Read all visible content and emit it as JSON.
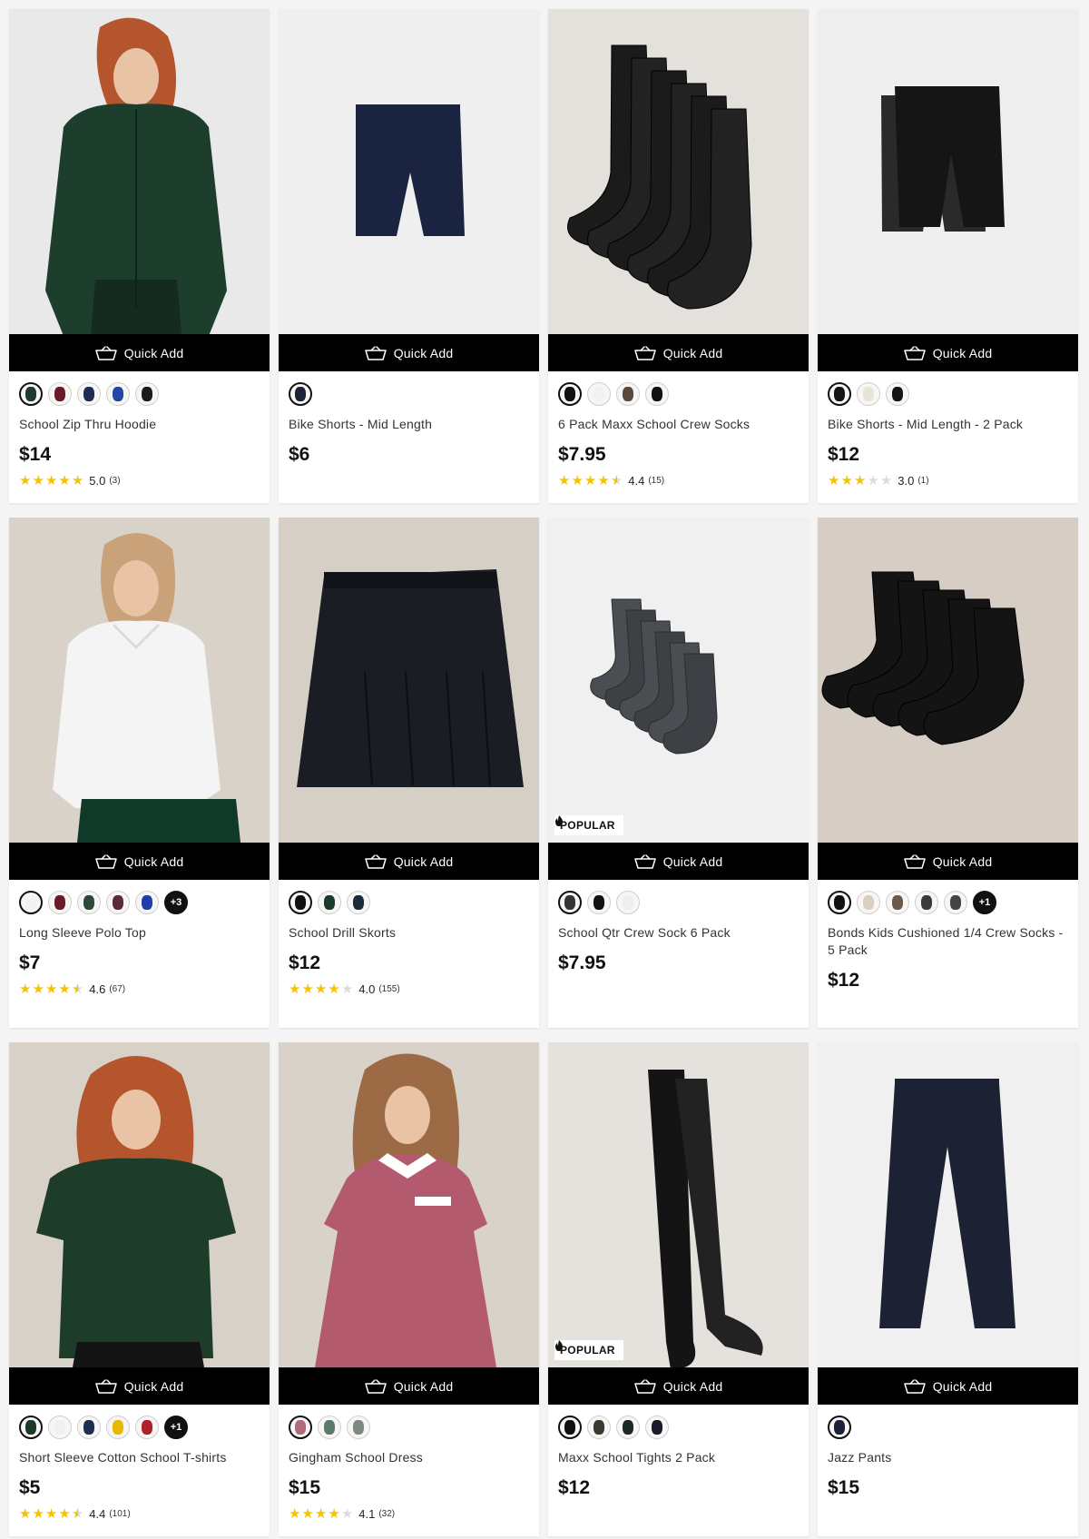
{
  "ui": {
    "quick_add_label": "Quick Add",
    "popular_label": "POPULAR",
    "colors": {
      "bar": "#000000",
      "star": "#f5c400",
      "star_empty": "#dddddd",
      "card_bg": "#ffffff",
      "page_bg": "#f4f4f4"
    }
  },
  "products": [
    {
      "name": "School Zip Thru Hoodie",
      "price": "$14",
      "rating": {
        "stars": 5,
        "value": "5.0",
        "count": "(3)"
      },
      "swatches": [
        "#1f3a2e",
        "#6b1a2a",
        "#1f2d52",
        "#2146a8",
        "#1b1b1b"
      ],
      "more": null,
      "popular": false,
      "image": {
        "bg": "#e9e9e9",
        "subject": "hoodie-model",
        "color": "#1d3d2d"
      }
    },
    {
      "name": "Bike Shorts - Mid Length",
      "price": "$6",
      "rating": null,
      "swatches": [
        "#1c2338"
      ],
      "more": null,
      "popular": false,
      "image": {
        "bg": "#efefef",
        "subject": "shorts",
        "color": "#1a2340"
      }
    },
    {
      "name": "6 Pack Maxx School Crew Socks",
      "price": "$7.95",
      "rating": {
        "stars": 4.5,
        "value": "4.4",
        "count": "(15)"
      },
      "swatches": [
        "#111111",
        "#f2f2f2",
        "#5a4a3a",
        "#111111"
      ],
      "more": null,
      "popular": false,
      "image": {
        "bg": "#e4e1dc",
        "subject": "crew-socks",
        "color": "#1b1b1b"
      }
    },
    {
      "name": "Bike Shorts - Mid Length - 2 Pack",
      "price": "$12",
      "rating": {
        "stars": 3,
        "value": "3.0",
        "count": "(1)"
      },
      "swatches": [
        "#141414",
        "#e8e4d8",
        "#141414"
      ],
      "more": null,
      "popular": false,
      "image": {
        "bg": "#eeeeee",
        "subject": "shorts-2pack",
        "color": "#151515"
      }
    },
    {
      "name": "Long Sleeve Polo Top",
      "price": "$7",
      "rating": {
        "stars": 4.5,
        "value": "4.6",
        "count": "(67)"
      },
      "swatches": [
        "#f2f2f2",
        "#6b1a2a",
        "#2d4a38",
        "#5a2a3a",
        "#1f3fa8"
      ],
      "more": "+3",
      "popular": false,
      "image": {
        "bg": "#d9d2c9",
        "subject": "polo-model",
        "color": "#f4f4f4"
      }
    },
    {
      "name": "School Drill Skorts",
      "price": "$12",
      "rating": {
        "stars": 4,
        "value": "4.0",
        "count": "(155)"
      },
      "swatches": [
        "#111111",
        "#1a3a2a",
        "#1a2a3a"
      ],
      "more": null,
      "popular": false,
      "image": {
        "bg": "#d6cfc6",
        "subject": "skort",
        "color": "#1a1d24"
      }
    },
    {
      "name": "School Qtr Crew Sock 6 Pack",
      "price": "$7.95",
      "rating": null,
      "swatches": [
        "#333333",
        "#111111",
        "#eeeeee"
      ],
      "more": null,
      "popular": true,
      "image": {
        "bg": "#f0f0f0",
        "subject": "qtr-socks",
        "color": "#4a4d52"
      }
    },
    {
      "name": "Bonds Kids Cushioned 1/4 Crew Socks - 5 Pack",
      "price": "$12",
      "rating": null,
      "swatches": [
        "#111111",
        "#d8cfc0",
        "#6a5a4a",
        "#3a3a3a",
        "#444444"
      ],
      "more": "+1",
      "popular": false,
      "image": {
        "bg": "#d6cec5",
        "subject": "quarter-socks",
        "color": "#141414"
      }
    },
    {
      "name": "Short Sleeve Cotton School T-shirts",
      "price": "$5",
      "rating": {
        "stars": 4.5,
        "value": "4.4",
        "count": "(101)"
      },
      "swatches": [
        "#1c3a28",
        "#f0f0f0",
        "#1f2d52",
        "#e8b800",
        "#b0202a"
      ],
      "more": "+1",
      "popular": false,
      "image": {
        "bg": "#d8d1c8",
        "subject": "tee-model",
        "color": "#1d3d2a"
      }
    },
    {
      "name": "Gingham School Dress",
      "price": "$15",
      "rating": {
        "stars": 4,
        "value": "4.1",
        "count": "(32)"
      },
      "swatches": [
        "#b06a78",
        "#5a7a6a",
        "#7a8a80"
      ],
      "more": null,
      "popular": false,
      "image": {
        "bg": "#d9d2ca",
        "subject": "dress-model",
        "color": "#b45a6e"
      }
    },
    {
      "name": "Maxx School Tights 2 Pack",
      "price": "$12",
      "rating": null,
      "swatches": [
        "#111111",
        "#3a3a30",
        "#1a2a22",
        "#1a1a2a"
      ],
      "more": null,
      "popular": true,
      "image": {
        "bg": "#e5e2dd",
        "subject": "tights",
        "color": "#141414"
      }
    },
    {
      "name": "Jazz Pants",
      "price": "$15",
      "rating": null,
      "swatches": [
        "#1c2338"
      ],
      "more": null,
      "popular": false,
      "image": {
        "bg": "#f0f0f0",
        "subject": "pants",
        "color": "#1c2233"
      }
    }
  ]
}
